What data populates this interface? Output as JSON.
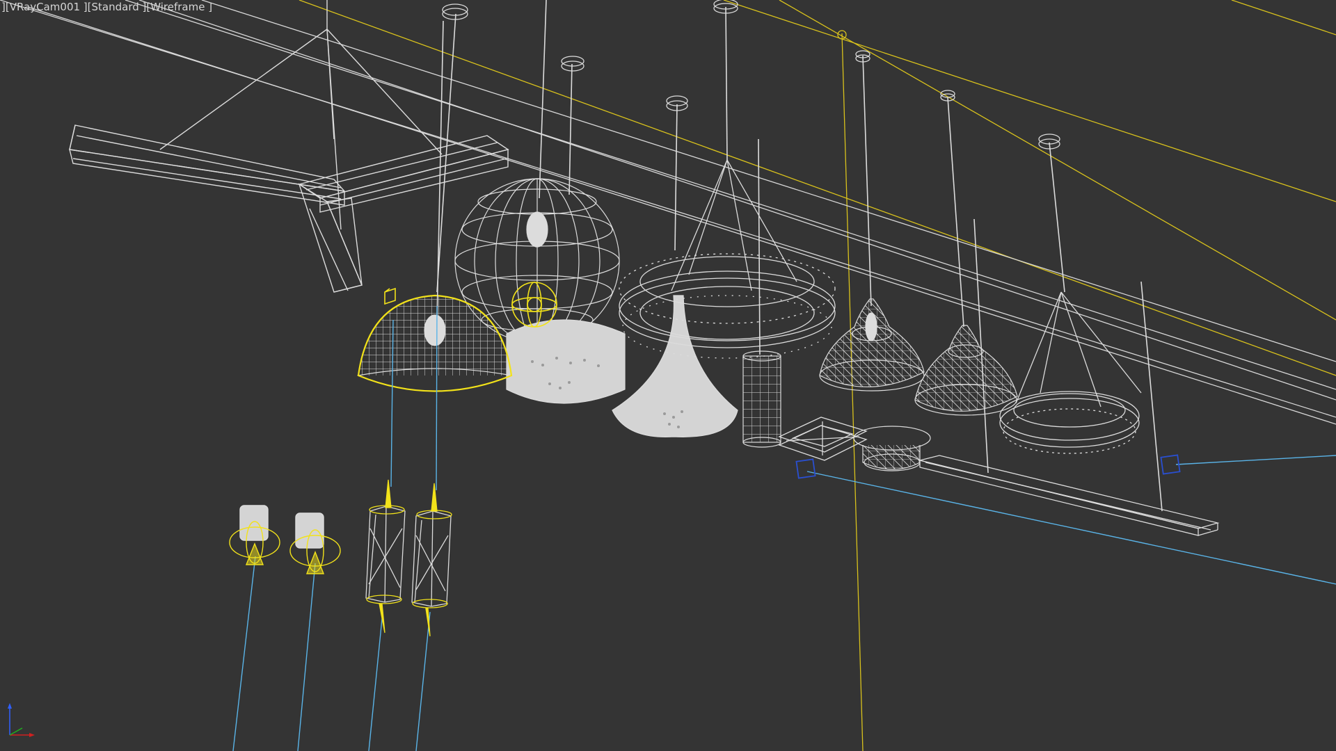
{
  "viewport": {
    "menu_bracket": "]",
    "camera_label": "[VRayCam001 ]",
    "shading_label": "[Standard ]",
    "display_mode_label": "[Wireframe ]"
  },
  "colors": {
    "background": "#343434",
    "wire": "#dcdcdc",
    "selected_wire": "#f2e21a",
    "target_line": "#5ab4e8",
    "target_box": "#2a4fd0",
    "camera_line": "#d9c21c",
    "axis_x": "#d02020",
    "axis_y": "#20b020",
    "axis_z": "#3060ff"
  },
  "gizmo": {
    "icon": "xyz-axis-tripod-icon"
  }
}
